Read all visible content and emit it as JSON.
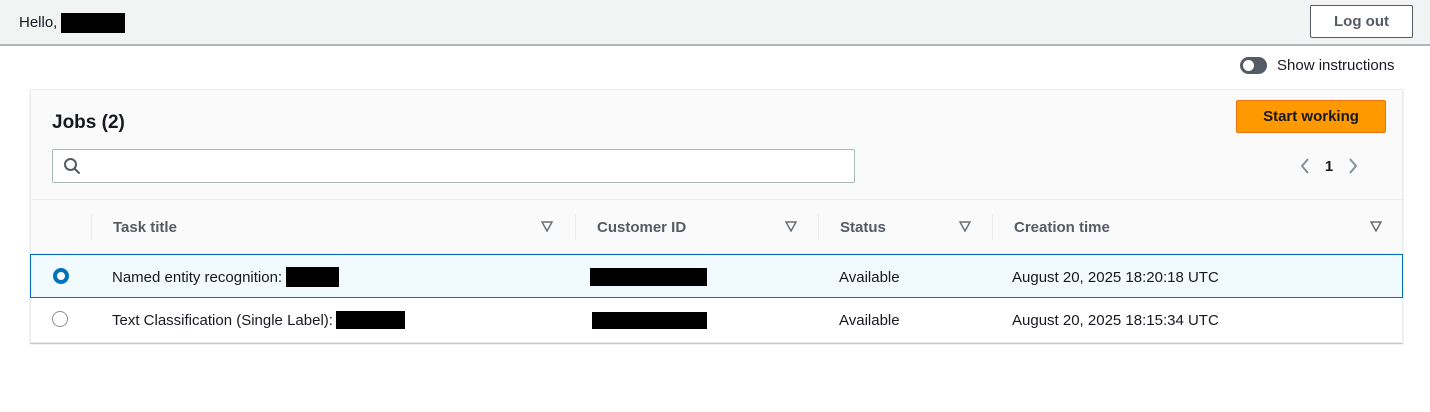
{
  "header": {
    "greeting": "Hello,",
    "logout_label": "Log out"
  },
  "instructions_toggle": {
    "label": "Show instructions",
    "checked": false
  },
  "jobs_panel": {
    "title": "Jobs (2)",
    "start_label": "Start working",
    "search": {
      "value": "",
      "placeholder": ""
    },
    "pagination": {
      "current_page": "1"
    },
    "columns": [
      "Task title",
      "Customer ID",
      "Status",
      "Creation time"
    ],
    "rows": [
      {
        "selected": true,
        "task_title": "Named entity recognition:",
        "status": "Available",
        "creation_time": "August 20, 2025 18:20:18 UTC"
      },
      {
        "selected": false,
        "task_title": "Text Classification (Single Label):",
        "status": "Available",
        "creation_time": "August 20, 2025 18:15:34 UTC"
      }
    ]
  },
  "colors": {
    "accent_orange": "#ff9900",
    "selection_blue": "#0073bb",
    "header_bg": "#f2f3f3"
  }
}
